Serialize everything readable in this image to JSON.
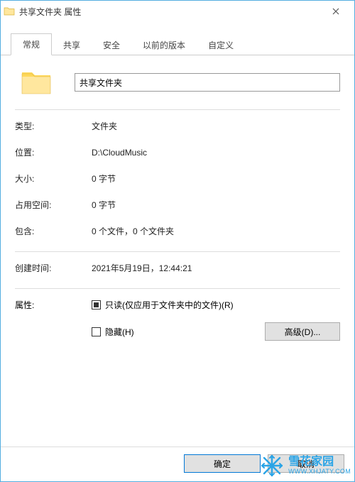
{
  "window": {
    "title": "共享文件夹 属性"
  },
  "tabs": {
    "general": "常规",
    "sharing": "共享",
    "security": "安全",
    "previous": "以前的版本",
    "customize": "自定义"
  },
  "folder": {
    "name": "共享文件夹"
  },
  "labels": {
    "type": "类型:",
    "location": "位置:",
    "size": "大小:",
    "size_on_disk": "占用空间:",
    "contains": "包含:",
    "created": "创建时间:",
    "attributes": "属性:"
  },
  "values": {
    "type": "文件夹",
    "location": "D:\\CloudMusic",
    "size": "0 字节",
    "size_on_disk": "0 字节",
    "contains": "0 个文件，0 个文件夹",
    "created": "2021年5月19日，12:44:21"
  },
  "attributes": {
    "readonly_label": "只读(仅应用于文件夹中的文件)(R)",
    "hidden_label": "隐藏(H)",
    "advanced": "高级(D)..."
  },
  "buttons": {
    "ok": "确定",
    "cancel": "取消"
  },
  "watermark": {
    "name": "雪花家园",
    "url": "WWW.XHJATY.COM"
  }
}
